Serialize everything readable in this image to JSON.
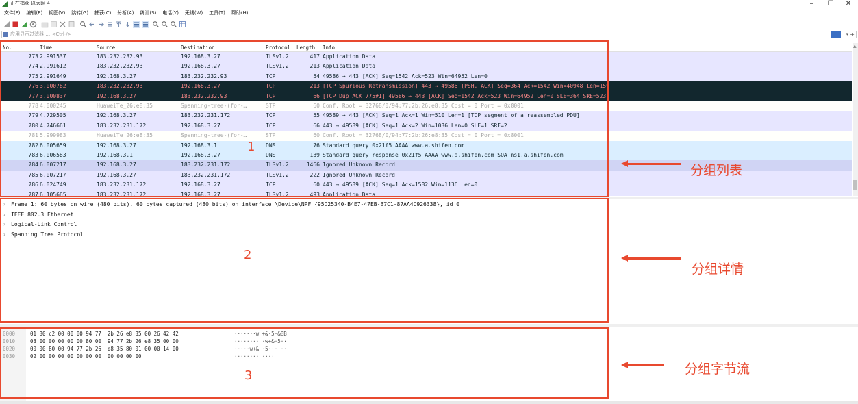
{
  "window": {
    "title": "正在捕获 以太网 4",
    "controls": [
      "–",
      "☐",
      "✕"
    ]
  },
  "menu": [
    "文件(F)",
    "编辑(E)",
    "视图(V)",
    "跳转(G)",
    "捕获(C)",
    "分析(A)",
    "统计(S)",
    "电话(Y)",
    "无线(W)",
    "工具(T)",
    "帮助(H)"
  ],
  "filter": {
    "placeholder": "应用显示过滤器 … <Ctrl-/>"
  },
  "columns": [
    "No.",
    "Time",
    "Source",
    "Destination",
    "Protocol",
    "Length",
    "Info"
  ],
  "packets": [
    {
      "no": "773",
      "time": "2.991537",
      "src": "183.232.232.93",
      "dst": "192.168.3.27",
      "proto": "TLSv1.2",
      "len": "417",
      "info": "Application Data",
      "bg": "#e7e6ff",
      "fg": "#12272e"
    },
    {
      "no": "774",
      "time": "2.991612",
      "src": "183.232.232.93",
      "dst": "192.168.3.27",
      "proto": "TLSv1.2",
      "len": "213",
      "info": "Application Data",
      "bg": "#e7e6ff",
      "fg": "#12272e"
    },
    {
      "no": "775",
      "time": "2.991649",
      "src": "192.168.3.27",
      "dst": "183.232.232.93",
      "proto": "TCP",
      "len": "54",
      "info": "49586 → 443 [ACK] Seq=1542 Ack=523 Win=64952 Len=0",
      "bg": "#e7e6ff",
      "fg": "#12272e"
    },
    {
      "no": "776",
      "time": "3.000782",
      "src": "183.232.232.93",
      "dst": "192.168.3.27",
      "proto": "TCP",
      "len": "213",
      "info": "[TCP Spurious Retransmission] 443 → 49586 [PSH, ACK] Seq=364 Ack=1542 Win=40948 Len=159",
      "bg": "#12272e",
      "fg": "#f78787"
    },
    {
      "no": "777",
      "time": "3.000837",
      "src": "192.168.3.27",
      "dst": "183.232.232.93",
      "proto": "TCP",
      "len": "66",
      "info": "[TCP Dup ACK 775#1] 49586 → 443 [ACK] Seq=1542 Ack=523 Win=64952 Len=0 SLE=364 SRE=523",
      "bg": "#12272e",
      "fg": "#f78787"
    },
    {
      "no": "778",
      "time": "4.000245",
      "src": "HuaweiTe_26:e8:35",
      "dst": "Spanning-tree-(for-…",
      "proto": "STP",
      "len": "60",
      "info": "Conf. Root = 32768/0/94:77:2b:26:e8:35  Cost = 0  Port = 0x8001",
      "bg": "#fffffc",
      "fg": "#a8a8a8"
    },
    {
      "no": "779",
      "time": "4.729505",
      "src": "192.168.3.27",
      "dst": "183.232.231.172",
      "proto": "TCP",
      "len": "55",
      "info": "49589 → 443 [ACK] Seq=1 Ack=1 Win=510 Len=1 [TCP segment of a reassembled PDU]",
      "bg": "#e7e6ff",
      "fg": "#12272e"
    },
    {
      "no": "780",
      "time": "4.746661",
      "src": "183.232.231.172",
      "dst": "192.168.3.27",
      "proto": "TCP",
      "len": "66",
      "info": "443 → 49589 [ACK] Seq=1 Ack=2 Win=1036 Len=0 SLE=1 SRE=2",
      "bg": "#e7e6ff",
      "fg": "#12272e"
    },
    {
      "no": "781",
      "time": "5.999983",
      "src": "HuaweiTe_26:e8:35",
      "dst": "Spanning-tree-(for-…",
      "proto": "STP",
      "len": "60",
      "info": "Conf. Root = 32768/0/94:77:2b:26:e8:35  Cost = 0  Port = 0x8001",
      "bg": "#fffffc",
      "fg": "#a8a8a8"
    },
    {
      "no": "782",
      "time": "6.005659",
      "src": "192.168.3.27",
      "dst": "192.168.3.1",
      "proto": "DNS",
      "len": "76",
      "info": "Standard query 0x21f5 AAAA www.a.shifen.com",
      "bg": "#daeeff",
      "fg": "#12272e"
    },
    {
      "no": "783",
      "time": "6.006583",
      "src": "192.168.3.1",
      "dst": "192.168.3.27",
      "proto": "DNS",
      "len": "139",
      "info": "Standard query response 0x21f5 AAAA www.a.shifen.com SOA ns1.a.shifen.com",
      "bg": "#daeeff",
      "fg": "#12272e"
    },
    {
      "no": "784",
      "time": "6.007217",
      "src": "192.168.3.27",
      "dst": "183.232.231.172",
      "proto": "TLSv1.2",
      "len": "1466",
      "info": "Ignored Unknown Record",
      "bg": "#d0d4f4",
      "fg": "#12272e"
    },
    {
      "no": "785",
      "time": "6.007217",
      "src": "192.168.3.27",
      "dst": "183.232.231.172",
      "proto": "TLSv1.2",
      "len": "222",
      "info": "Ignored Unknown Record",
      "bg": "#e7e6ff",
      "fg": "#12272e"
    },
    {
      "no": "786",
      "time": "6.024749",
      "src": "183.232.231.172",
      "dst": "192.168.3.27",
      "proto": "TCP",
      "len": "60",
      "info": "443 → 49589 [ACK] Seq=1 Ack=1582 Win=1136 Len=0",
      "bg": "#e7e6ff",
      "fg": "#12272e"
    },
    {
      "no": "787",
      "time": "6.105665",
      "src": "183.232.231.172",
      "dst": "192.168.3.27",
      "proto": "TLSv1.2",
      "len": "493",
      "info": "Application Data",
      "bg": "#e7e6ff",
      "fg": "#12272e"
    }
  ],
  "details": [
    "Frame 1: 60 bytes on wire (480 bits), 60 bytes captured (480 bits) on interface \\Device\\NPF_{95D25340-B4E7-47EB-B7C1-87AA4C926338}, id 0",
    "IEEE 802.3 Ethernet",
    "Logical-Link Control",
    "Spanning Tree Protocol"
  ],
  "bytes": [
    {
      "offset": "0000",
      "hex": "01 80 c2 00 00 00 94 77  2b 26 e8 35 00 26 42 42",
      "ascii": "·······w +&·5·&BB"
    },
    {
      "offset": "0010",
      "hex": "03 00 00 00 00 00 80 00  94 77 2b 26 e8 35 00 00",
      "ascii": "········ ·w+&·5··"
    },
    {
      "offset": "0020",
      "hex": "00 00 80 00 94 77 2b 26  e8 35 80 01 00 00 14 00",
      "ascii": "·····w+& ·5······"
    },
    {
      "offset": "0030",
      "hex": "02 00 00 00 00 00 00 00  00 00 00 00",
      "ascii": "········ ····"
    }
  ],
  "annotations": {
    "n1": "1",
    "n2": "2",
    "n3": "3",
    "list_label": "分组列表",
    "details_label": "分组详情",
    "bytes_label": "分组字节流"
  },
  "colors": {
    "annotation": "#e8492f"
  }
}
